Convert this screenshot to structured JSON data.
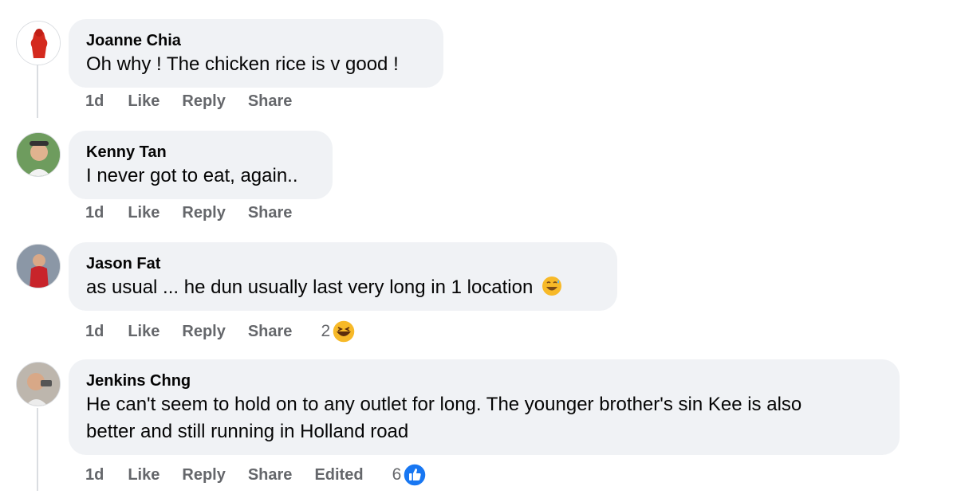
{
  "comments": [
    {
      "author": "Joanne Chia",
      "text": "Oh why ! The chicken rice is v good !",
      "time": "1d",
      "actions": {
        "like": "Like",
        "reply": "Reply",
        "share": "Share"
      }
    },
    {
      "author": "Kenny Tan",
      "text": "I never got to eat, again..",
      "time": "1d",
      "actions": {
        "like": "Like",
        "reply": "Reply",
        "share": "Share"
      }
    },
    {
      "author": "Jason Fat",
      "text": "as usual ... he dun usually last very long in 1 location",
      "time": "1d",
      "actions": {
        "like": "Like",
        "reply": "Reply",
        "share": "Share"
      },
      "reactions": {
        "count": "2",
        "icon": "haha-emoji-icon"
      }
    },
    {
      "author": "Jenkins Chng",
      "text_line1": "He can't seem to hold on to any outlet for long. The younger brother's sin Kee is also",
      "text_line2": "better and still running in Holland road",
      "time": "1d",
      "actions": {
        "like": "Like",
        "reply": "Reply",
        "share": "Share"
      },
      "edited": "Edited",
      "reactions": {
        "count": "6",
        "icon": "like-thumb-icon"
      }
    }
  ],
  "colors": {
    "bubble": "#f0f2f5",
    "meta": "#65676b",
    "like_blue": "#1877f2",
    "haha_yellow": "#f7b928"
  }
}
